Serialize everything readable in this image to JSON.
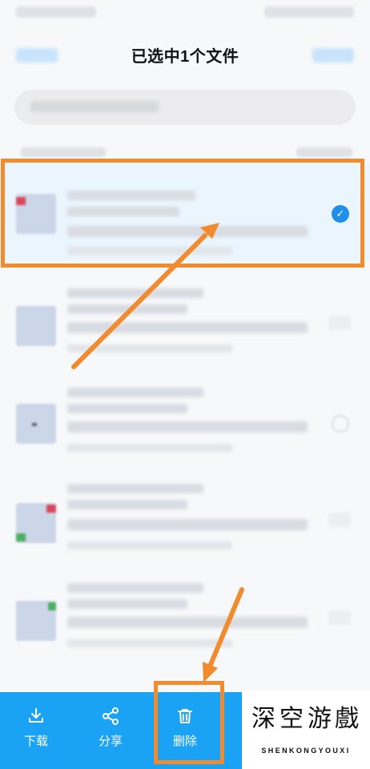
{
  "header": {
    "title": "已选中1个文件"
  },
  "files": [
    {
      "selected": true
    },
    {
      "selected": false
    },
    {
      "selected": false
    },
    {
      "selected": false
    },
    {
      "selected": false
    }
  ],
  "bottom_bar": {
    "actions": [
      {
        "label": "下载",
        "icon": "download-icon"
      },
      {
        "label": "分享",
        "icon": "share-icon"
      },
      {
        "label": "删除",
        "icon": "trash-icon"
      }
    ]
  },
  "watermark": {
    "chars": [
      "深",
      "空",
      "游",
      "戲"
    ],
    "sub": "SHENKONGYOUXI"
  },
  "colors": {
    "accent": "#1aa2f5",
    "highlight": "#f28a2e",
    "check": "#1f8fe9"
  }
}
